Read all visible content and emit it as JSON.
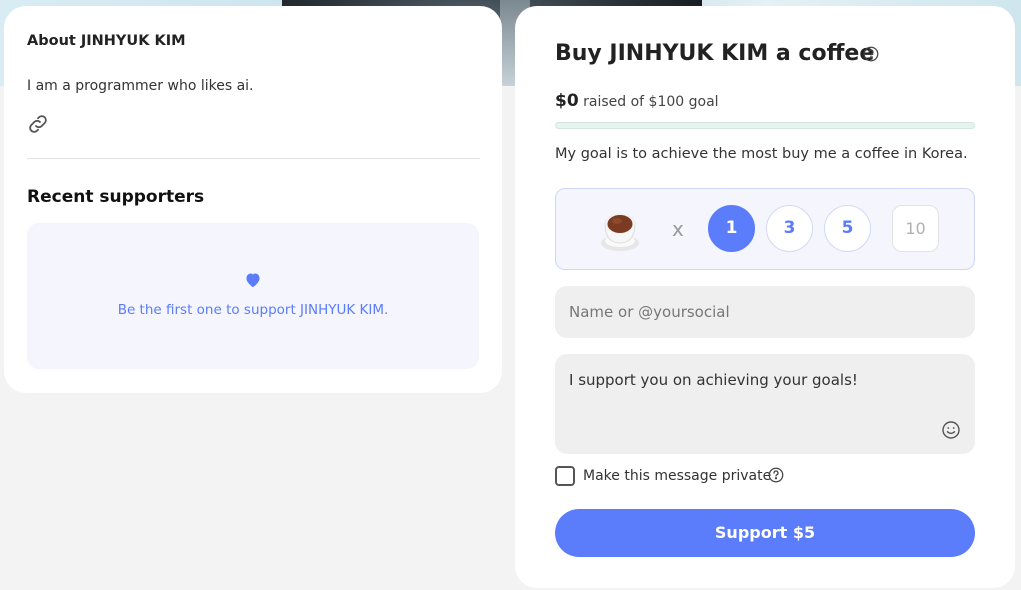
{
  "about": {
    "title": "About JINHYUK KIM",
    "bio": "I am a programmer who likes ai."
  },
  "recent": {
    "title": "Recent supporters",
    "empty_message": "Be the first one to support JINHYUK KIM."
  },
  "widget": {
    "title": "Buy JINHYUK KIM a coffee",
    "raised_amount": "$0",
    "raised_text": "raised of $100 goal",
    "progress_fraction": 0,
    "goal_description": "My goal is to achieve the most buy me a coffee in Korea.",
    "multiplier": "x",
    "quantities": [
      "1",
      "3",
      "5"
    ],
    "selected_quantity": "1",
    "custom_quantity_placeholder": "10",
    "name_placeholder": "Name or @yoursocial",
    "message_value": "I support you on achieving your goals!",
    "private_label": "Make this message private",
    "private_checked": false,
    "support_button": "Support $5"
  },
  "icons": {
    "link": "link-icon",
    "heart": "heart-icon",
    "help": "question-circle-icon",
    "coffee": "coffee-cup-icon",
    "emoji": "smile-icon"
  },
  "colors": {
    "accent": "#5b7cfb",
    "soft_accent_bg": "#f4f5fd",
    "progress_track": "#e6f3ee"
  }
}
